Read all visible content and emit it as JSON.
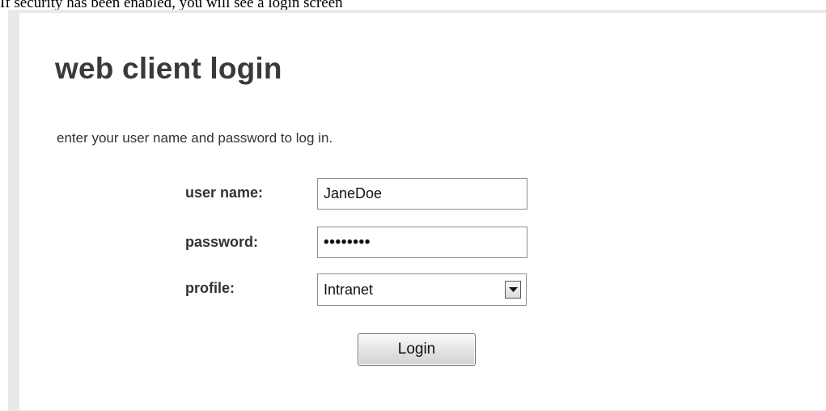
{
  "caption": "If security has been enabled, you will see a login screen",
  "login": {
    "title": "web client login",
    "instructions": "enter your user name and password to log in.",
    "username_label": "user name:",
    "username_value": "JaneDoe",
    "password_label": "password:",
    "password_mask": "••••••••",
    "profile_label": "profile:",
    "profile_selected": "Intranet",
    "login_button": "Login"
  },
  "icons": {
    "dropdown": "chevron-down-icon"
  },
  "colors": {
    "frame_background": "#e9e9e9",
    "panel_background": "#ffffff",
    "title_text": "#3a3a3a",
    "body_text": "#333333"
  }
}
